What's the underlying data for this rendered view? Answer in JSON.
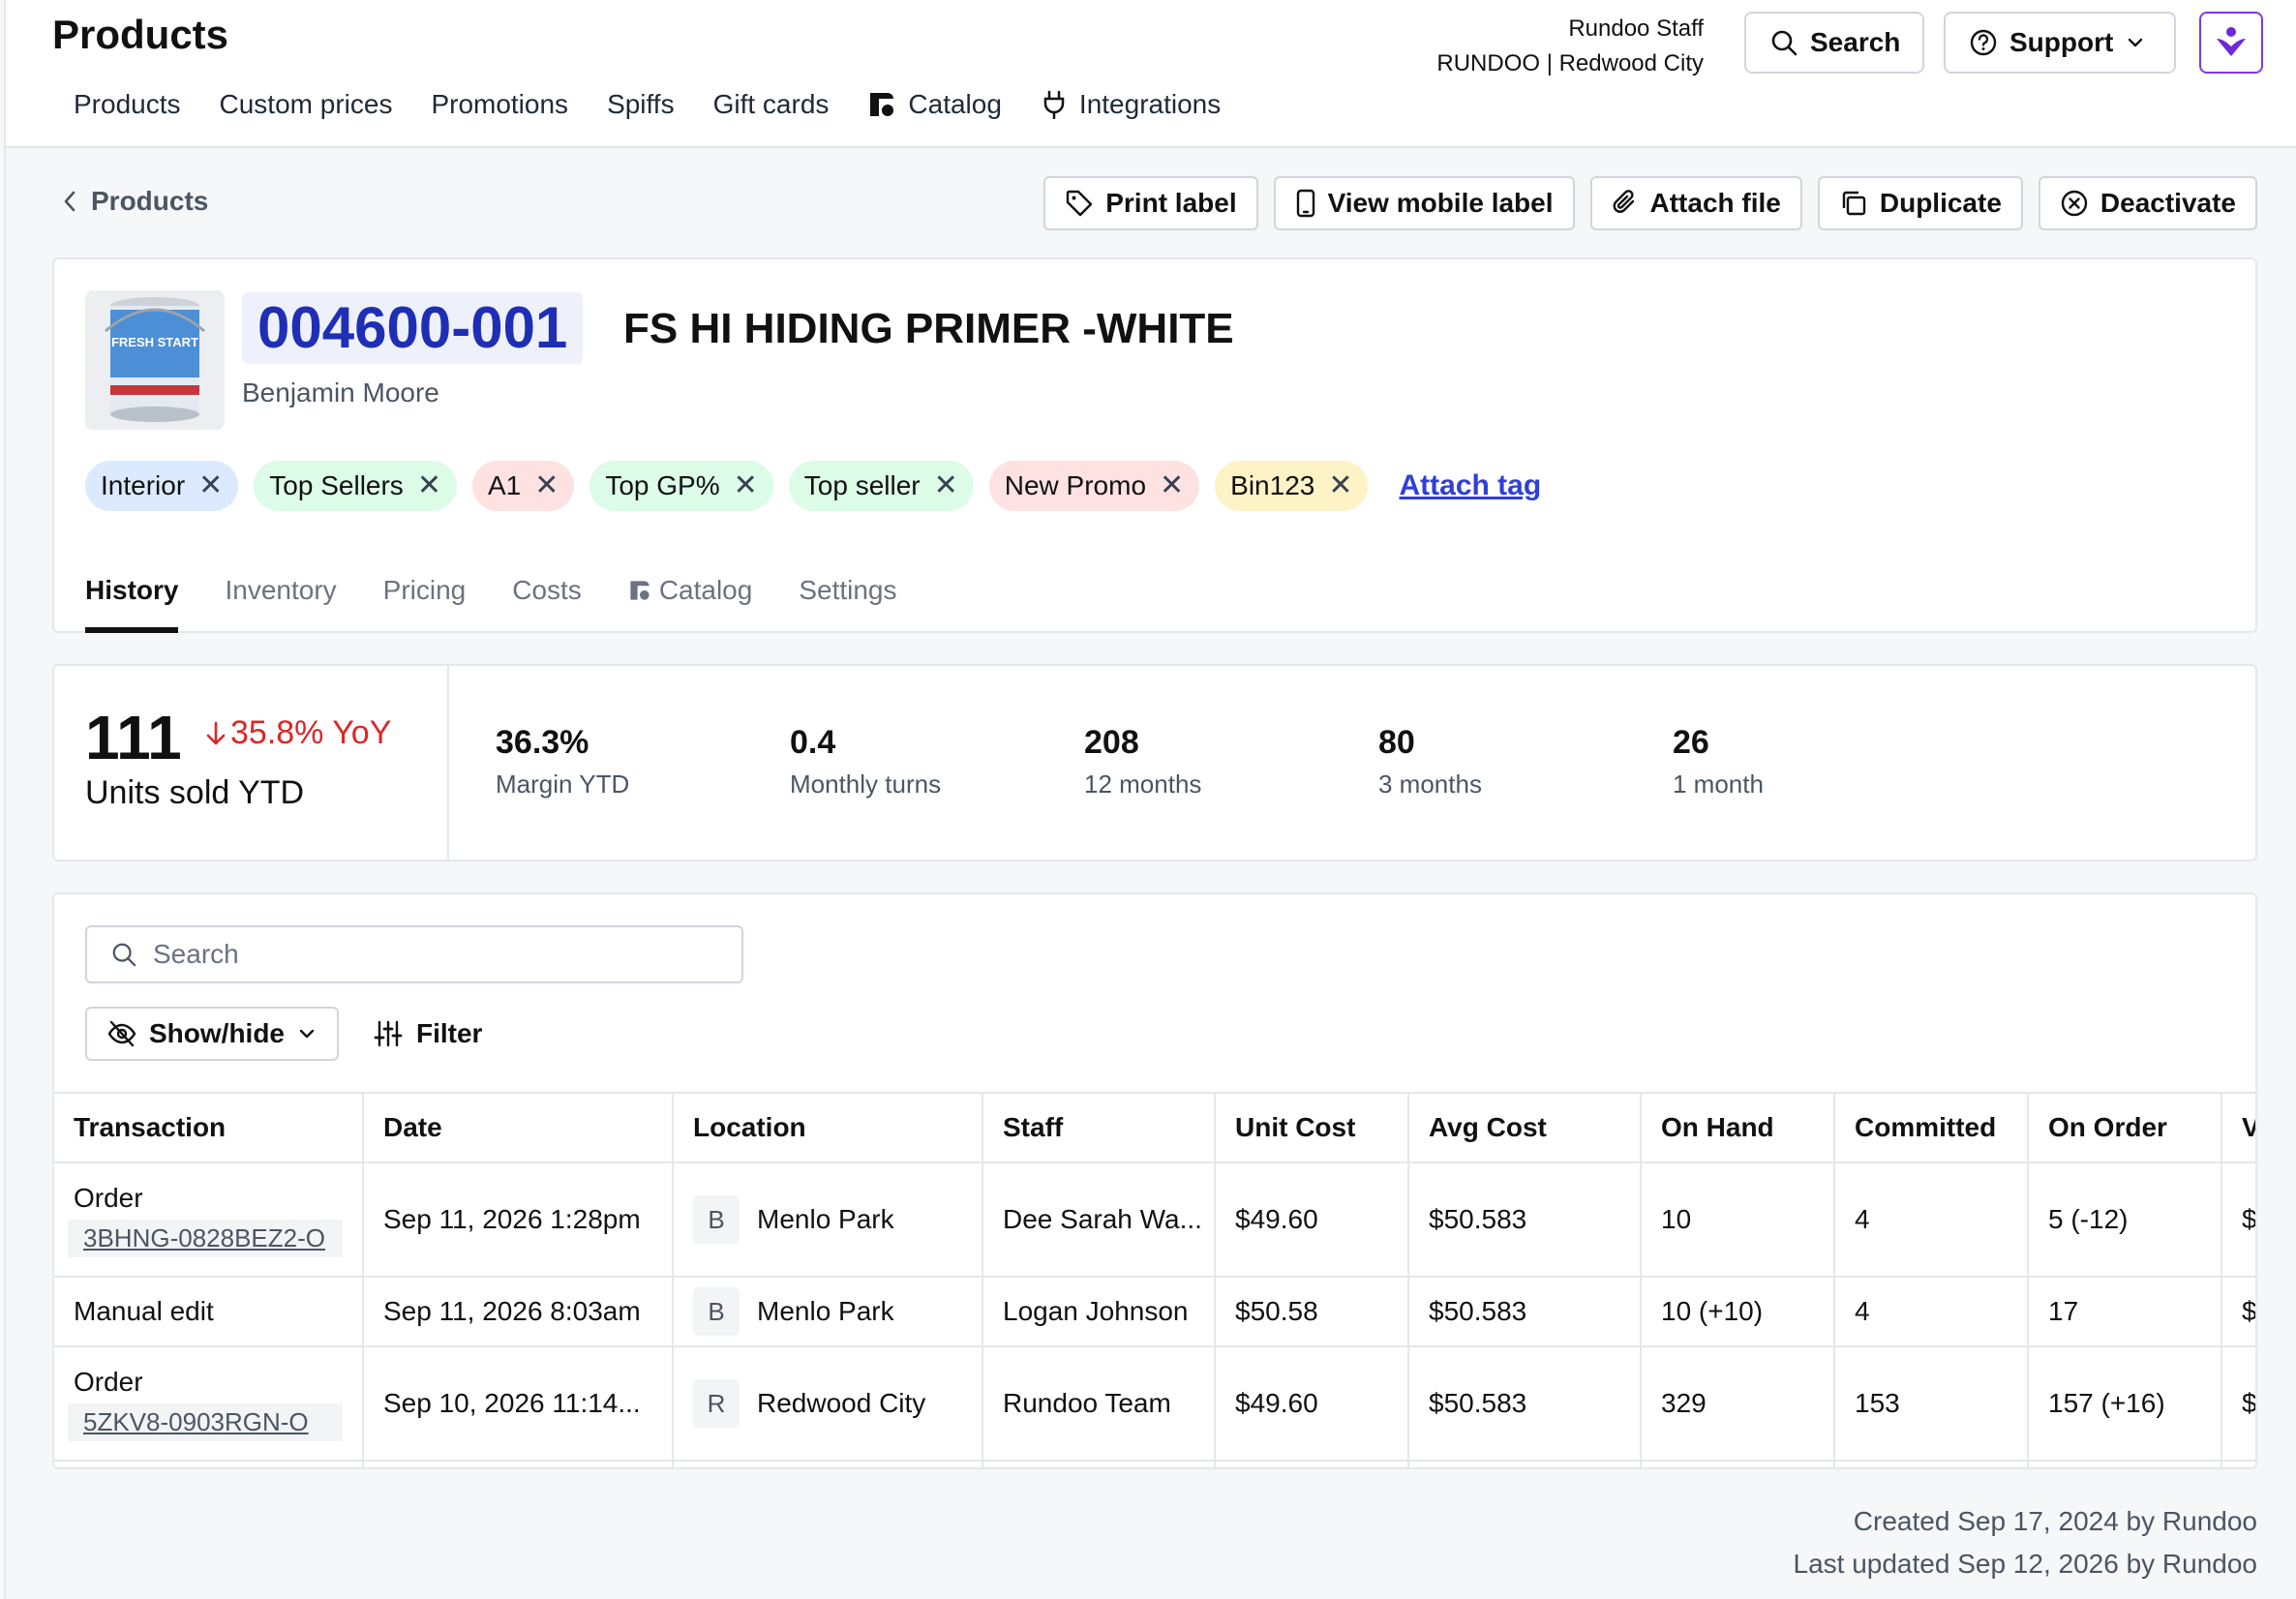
{
  "header": {
    "title": "Products",
    "nav": [
      "Products",
      "Custom prices",
      "Promotions",
      "Spiffs",
      "Gift cards",
      "Catalog",
      "Integrations"
    ],
    "user": "Rundoo Staff",
    "org": "RUNDOO | Redwood City",
    "search_label": "Search",
    "support_label": "Support"
  },
  "breadcrumb": {
    "back_label": "Products"
  },
  "actions": [
    "Print label",
    "View mobile label",
    "Attach file",
    "Duplicate",
    "Deactivate"
  ],
  "product": {
    "sku": "004600-001",
    "name": "FS HI HIDING PRIMER -WHITE",
    "brand": "Benjamin Moore",
    "image_text": "FRESH START",
    "tags": [
      {
        "label": "Interior",
        "color": "#dbeafe"
      },
      {
        "label": "Top Sellers",
        "color": "#dcfce7"
      },
      {
        "label": "A1",
        "color": "#fee2e2"
      },
      {
        "label": "Top GP%",
        "color": "#dcfce7"
      },
      {
        "label": "Top seller",
        "color": "#dcfce7"
      },
      {
        "label": "New Promo",
        "color": "#fee2e2"
      },
      {
        "label": "Bin123",
        "color": "#fef3c7"
      }
    ],
    "attach_tag_label": "Attach tag",
    "tabs": [
      "History",
      "Inventory",
      "Pricing",
      "Costs",
      "Catalog",
      "Settings"
    ]
  },
  "stats": {
    "units_sold": "111",
    "yoy": "35.8% YoY",
    "units_label": "Units sold YTD",
    "items": [
      {
        "value": "36.3%",
        "label": "Margin YTD"
      },
      {
        "value": "0.4",
        "label": "Monthly turns"
      },
      {
        "value": "208",
        "label": "12 months"
      },
      {
        "value": "80",
        "label": "3 months"
      },
      {
        "value": "26",
        "label": "1 month"
      }
    ]
  },
  "table": {
    "search_placeholder": "Search",
    "showhide_label": "Show/hide",
    "filter_label": "Filter",
    "columns": [
      "Transaction",
      "Date",
      "Location",
      "Staff",
      "Unit Cost",
      "Avg Cost",
      "On Hand",
      "Committed",
      "On Order",
      "V"
    ],
    "rows": [
      {
        "transaction": "Order",
        "ref": "3BHNG-0828BEZ2-O",
        "date": "Sep 11, 2026 1:28pm",
        "loc_badge": "B",
        "location": "Menlo Park",
        "staff": "Dee Sarah Wa...",
        "unit_cost": "$49.60",
        "avg_cost": "$50.583",
        "on_hand": "10",
        "committed": "4",
        "on_order": "5 (-12)",
        "v": "$"
      },
      {
        "transaction": "Manual edit",
        "ref": "",
        "date": "Sep 11, 2026 8:03am",
        "loc_badge": "B",
        "location": "Menlo Park",
        "staff": "Logan Johnson",
        "unit_cost": "$50.58",
        "avg_cost": "$50.583",
        "on_hand": "10 (+10)",
        "committed": "4",
        "on_order": "17",
        "v": "$"
      },
      {
        "transaction": "Order",
        "ref": "5ZKV8-0903RGN-O",
        "date": "Sep 10, 2026 11:14...",
        "loc_badge": "R",
        "location": "Redwood City",
        "staff": "Rundoo Team",
        "unit_cost": "$49.60",
        "avg_cost": "$50.583",
        "on_hand": "329",
        "committed": "153",
        "on_order": "157 (+16)",
        "v": "$"
      }
    ]
  },
  "footer": {
    "created": "Created Sep 17, 2024 by Rundoo",
    "updated": "Last updated Sep 12, 2026 by Rundoo"
  }
}
